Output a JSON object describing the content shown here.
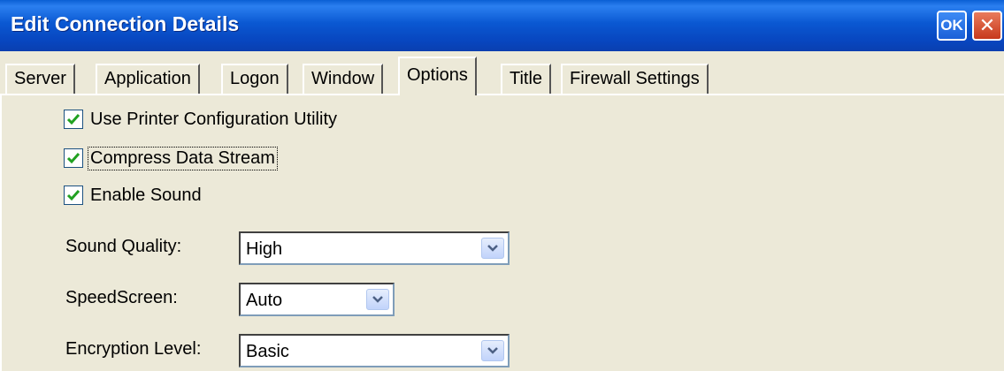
{
  "window": {
    "title": "Edit Connection Details",
    "ok_label": "OK",
    "close_glyph": "✕"
  },
  "tabs": [
    {
      "label": "Server"
    },
    {
      "label": "Application"
    },
    {
      "label": "Logon"
    },
    {
      "label": "Window"
    },
    {
      "label": "Options",
      "active": true
    },
    {
      "label": "Title"
    },
    {
      "label": "Firewall Settings"
    }
  ],
  "options": {
    "checkboxes": [
      {
        "label": "Use Printer Configuration Utility",
        "checked": true
      },
      {
        "label": "Compress Data Stream",
        "checked": true,
        "focused": true
      },
      {
        "label": "Enable Sound",
        "checked": true
      }
    ],
    "fields": [
      {
        "label": "Sound Quality:",
        "value": "High"
      },
      {
        "label": "SpeedScreen:",
        "value": "Auto"
      },
      {
        "label": "Encryption Level:",
        "value": "Basic"
      }
    ]
  },
  "colors": {
    "titlebar": "#0a58d2",
    "checkmark": "#21a121",
    "dialog_bg": "#ece9d8"
  }
}
